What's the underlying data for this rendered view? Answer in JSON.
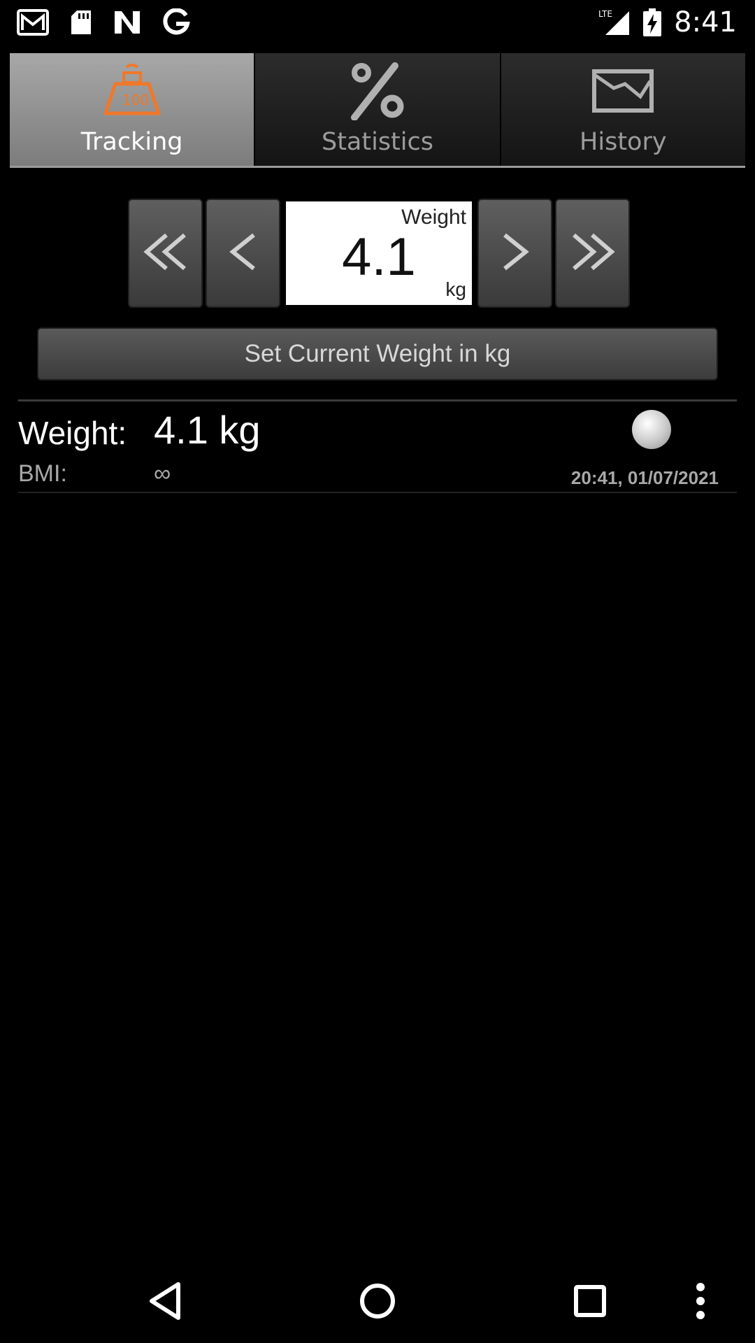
{
  "status_bar": {
    "time": "8:41",
    "network": "LTE",
    "left_icons": [
      "gmail-icon",
      "sd-card-icon",
      "n-app-icon",
      "google-icon"
    ],
    "right_icons": [
      "lte-signal-icon",
      "battery-charging-icon"
    ]
  },
  "tabs": [
    {
      "label": "Tracking",
      "icon": "weight-scale-icon",
      "active": true
    },
    {
      "label": "Statistics",
      "icon": "percent-icon",
      "active": false
    },
    {
      "label": "History",
      "icon": "chart-history-icon",
      "active": false
    }
  ],
  "picker": {
    "caption": "Weight",
    "value": "4.1",
    "unit": "kg"
  },
  "set_button_label": "Set Current Weight in kg",
  "entry": {
    "weight_label": "Weight:",
    "weight_value": "4.1 kg",
    "bmi_label": "BMI:",
    "bmi_value": "∞",
    "timestamp": "20:41, 01/07/2021"
  },
  "colors": {
    "accent": "#f0782a",
    "background": "#000000",
    "tab_active": "#8f8f8f",
    "muted_text": "#a8a8a8"
  },
  "nav_bar": [
    "back-icon",
    "home-icon",
    "recents-icon",
    "overflow-menu-icon"
  ]
}
